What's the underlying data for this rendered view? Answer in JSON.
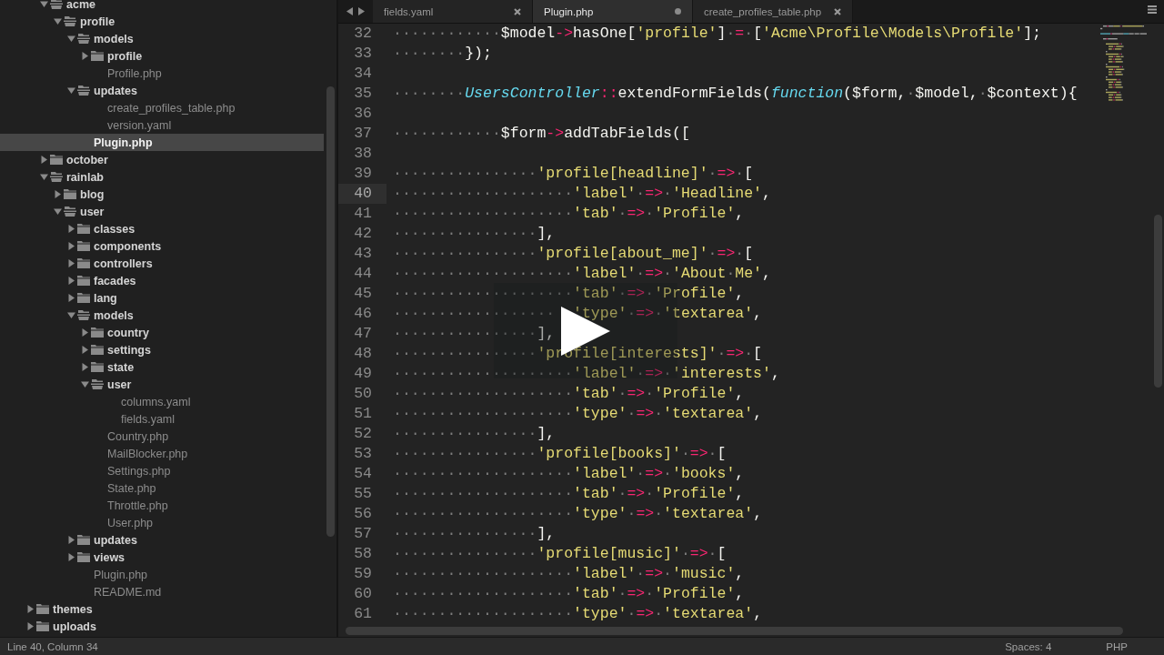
{
  "sidebar": {
    "tree": [
      {
        "children": [
          {
            "name": "acme",
            "kind": "folder",
            "expanded": true,
            "selected": false,
            "children": [
              {
                "name": "profile",
                "kind": "folder",
                "expanded": true,
                "selected": false,
                "children": [
                  {
                    "name": "models",
                    "kind": "folder",
                    "expanded": true,
                    "selected": false,
                    "children": [
                      {
                        "name": "profile",
                        "kind": "folder",
                        "expanded": false,
                        "selected": false
                      },
                      {
                        "name": "Profile.php",
                        "kind": "file",
                        "selected": false
                      }
                    ]
                  },
                  {
                    "name": "updates",
                    "kind": "folder",
                    "expanded": true,
                    "selected": false,
                    "children": [
                      {
                        "name": "create_profiles_table.php",
                        "kind": "file",
                        "selected": false
                      },
                      {
                        "name": "version.yaml",
                        "kind": "file",
                        "selected": false
                      }
                    ]
                  },
                  {
                    "name": "Plugin.php",
                    "kind": "file",
                    "selected": true
                  }
                ]
              }
            ]
          },
          {
            "name": "october",
            "kind": "folder",
            "expanded": false,
            "selected": false
          },
          {
            "name": "rainlab",
            "kind": "folder",
            "expanded": true,
            "selected": false,
            "children": [
              {
                "name": "blog",
                "kind": "folder",
                "expanded": false,
                "selected": false
              },
              {
                "name": "user",
                "kind": "folder",
                "expanded": true,
                "selected": false,
                "children": [
                  {
                    "name": "classes",
                    "kind": "folder",
                    "expanded": false,
                    "selected": false
                  },
                  {
                    "name": "components",
                    "kind": "folder",
                    "expanded": false,
                    "selected": false
                  },
                  {
                    "name": "controllers",
                    "kind": "folder",
                    "expanded": false,
                    "selected": false
                  },
                  {
                    "name": "facades",
                    "kind": "folder",
                    "expanded": false,
                    "selected": false
                  },
                  {
                    "name": "lang",
                    "kind": "folder",
                    "expanded": false,
                    "selected": false
                  },
                  {
                    "name": "models",
                    "kind": "folder",
                    "expanded": true,
                    "selected": false,
                    "children": [
                      {
                        "name": "country",
                        "kind": "folder",
                        "expanded": false,
                        "selected": false
                      },
                      {
                        "name": "settings",
                        "kind": "folder",
                        "expanded": false,
                        "selected": false
                      },
                      {
                        "name": "state",
                        "kind": "folder",
                        "expanded": false,
                        "selected": false
                      },
                      {
                        "name": "user",
                        "kind": "folder",
                        "expanded": true,
                        "selected": false,
                        "children": [
                          {
                            "name": "columns.yaml",
                            "kind": "file",
                            "selected": false
                          },
                          {
                            "name": "fields.yaml",
                            "kind": "file",
                            "selected": false
                          }
                        ]
                      },
                      {
                        "name": "Country.php",
                        "kind": "file",
                        "selected": false
                      },
                      {
                        "name": "MailBlocker.php",
                        "kind": "file",
                        "selected": false
                      },
                      {
                        "name": "Settings.php",
                        "kind": "file",
                        "selected": false
                      },
                      {
                        "name": "State.php",
                        "kind": "file",
                        "selected": false
                      },
                      {
                        "name": "Throttle.php",
                        "kind": "file",
                        "selected": false
                      },
                      {
                        "name": "User.php",
                        "kind": "file",
                        "selected": false
                      }
                    ]
                  },
                  {
                    "name": "updates",
                    "kind": "folder",
                    "expanded": false,
                    "selected": false
                  },
                  {
                    "name": "views",
                    "kind": "folder",
                    "expanded": false,
                    "selected": false
                  },
                  {
                    "name": "Plugin.php",
                    "kind": "file",
                    "selected": false
                  },
                  {
                    "name": "README.md",
                    "kind": "file",
                    "selected": false
                  }
                ]
              }
            ]
          }
        ]
      },
      {
        "name": "themes",
        "kind": "folder",
        "expanded": false,
        "selected": false
      },
      {
        "name": "uploads",
        "kind": "folder",
        "expanded": false,
        "selected": false
      }
    ]
  },
  "tabs": [
    {
      "label": "fields.yaml",
      "selected": false,
      "modified": false
    },
    {
      "label": "Plugin.php",
      "selected": true,
      "modified": true
    },
    {
      "label": "create_profiles_table.php",
      "selected": false,
      "modified": false
    }
  ],
  "code": [
    {
      "n": "32",
      "current": false,
      "tokens": [
        {
          "kind": "ws",
          "text": "············"
        },
        {
          "kind": "plain",
          "text": "$model"
        },
        {
          "kind": "op",
          "text": "->"
        },
        {
          "kind": "plain",
          "text": "hasOne["
        },
        {
          "kind": "str",
          "text": "'profile'"
        },
        {
          "kind": "plain",
          "text": "]"
        },
        {
          "kind": "ws",
          "text": "·"
        },
        {
          "kind": "op",
          "text": "="
        },
        {
          "kind": "ws",
          "text": "·"
        },
        {
          "kind": "plain",
          "text": "["
        },
        {
          "kind": "str",
          "text": "'Acme\\Profile\\Models\\Profile'"
        },
        {
          "kind": "plain",
          "text": "];"
        }
      ]
    },
    {
      "n": "33",
      "current": false,
      "tokens": [
        {
          "kind": "ws",
          "text": "········"
        },
        {
          "kind": "plain",
          "text": "});"
        }
      ]
    },
    {
      "n": "34",
      "current": false
    },
    {
      "n": "35",
      "current": false,
      "tokens": [
        {
          "kind": "ws",
          "text": "········"
        },
        {
          "kind": "cls",
          "text": "UsersController"
        },
        {
          "kind": "op",
          "text": "::"
        },
        {
          "kind": "plain",
          "text": "extendFormFields("
        },
        {
          "kind": "kw",
          "text": "function"
        },
        {
          "kind": "plain",
          "text": "($form,"
        },
        {
          "kind": "ws",
          "text": "·"
        },
        {
          "kind": "plain",
          "text": "$model,"
        },
        {
          "kind": "ws",
          "text": "·"
        },
        {
          "kind": "plain",
          "text": "$context){"
        }
      ]
    },
    {
      "n": "36",
      "current": false
    },
    {
      "n": "37",
      "current": false,
      "tokens": [
        {
          "kind": "ws",
          "text": "············"
        },
        {
          "kind": "plain",
          "text": "$form"
        },
        {
          "kind": "op",
          "text": "->"
        },
        {
          "kind": "plain",
          "text": "addTabFields(["
        }
      ]
    },
    {
      "n": "38",
      "current": false
    },
    {
      "n": "39",
      "current": false,
      "tokens": [
        {
          "kind": "ws",
          "text": "················"
        },
        {
          "kind": "str",
          "text": "'profile[headline]'"
        },
        {
          "kind": "ws",
          "text": "·"
        },
        {
          "kind": "op",
          "text": "=>"
        },
        {
          "kind": "ws",
          "text": "·"
        },
        {
          "kind": "plain",
          "text": "["
        }
      ]
    },
    {
      "n": "40",
      "current": true,
      "tokens": [
        {
          "kind": "ws",
          "text": "····················"
        },
        {
          "kind": "str",
          "text": "'label'"
        },
        {
          "kind": "ws",
          "text": "·"
        },
        {
          "kind": "op",
          "text": "=>"
        },
        {
          "kind": "ws",
          "text": "·"
        },
        {
          "kind": "str",
          "text": "'Headline'"
        },
        {
          "kind": "plain",
          "text": ","
        }
      ]
    },
    {
      "n": "41",
      "current": false,
      "tokens": [
        {
          "kind": "ws",
          "text": "····················"
        },
        {
          "kind": "str",
          "text": "'tab'"
        },
        {
          "kind": "ws",
          "text": "·"
        },
        {
          "kind": "op",
          "text": "=>"
        },
        {
          "kind": "ws",
          "text": "·"
        },
        {
          "kind": "str",
          "text": "'Profile'"
        },
        {
          "kind": "plain",
          "text": ","
        }
      ]
    },
    {
      "n": "42",
      "current": false,
      "tokens": [
        {
          "kind": "ws",
          "text": "················"
        },
        {
          "kind": "plain",
          "text": "],"
        }
      ]
    },
    {
      "n": "43",
      "current": false,
      "tokens": [
        {
          "kind": "ws",
          "text": "················"
        },
        {
          "kind": "str",
          "text": "'profile[about_me]'"
        },
        {
          "kind": "ws",
          "text": "·"
        },
        {
          "kind": "op",
          "text": "=>"
        },
        {
          "kind": "ws",
          "text": "·"
        },
        {
          "kind": "plain",
          "text": "["
        }
      ]
    },
    {
      "n": "44",
      "current": false,
      "tokens": [
        {
          "kind": "ws",
          "text": "····················"
        },
        {
          "kind": "str",
          "text": "'label'"
        },
        {
          "kind": "ws",
          "text": "·"
        },
        {
          "kind": "op",
          "text": "=>"
        },
        {
          "kind": "ws",
          "text": "·"
        },
        {
          "kind": "str",
          "text": "'About"
        },
        {
          "kind": "ws",
          "text": "·"
        },
        {
          "kind": "str",
          "text": "Me'"
        },
        {
          "kind": "plain",
          "text": ","
        }
      ]
    },
    {
      "n": "45",
      "current": false,
      "tokens": [
        {
          "kind": "ws",
          "text": "····················"
        },
        {
          "kind": "str",
          "text": "'tab'"
        },
        {
          "kind": "ws",
          "text": "·"
        },
        {
          "kind": "op",
          "text": "=>"
        },
        {
          "kind": "ws",
          "text": "·"
        },
        {
          "kind": "str",
          "text": "'Profile'"
        },
        {
          "kind": "plain",
          "text": ","
        }
      ]
    },
    {
      "n": "46",
      "current": false,
      "tokens": [
        {
          "kind": "ws",
          "text": "··················"
        },
        {
          "kind": "covered"
        },
        {
          "kind": "str",
          "text": "'type'"
        },
        {
          "kind": "ws",
          "text": "·"
        },
        {
          "kind": "op",
          "text": "=>"
        },
        {
          "kind": "ws",
          "text": "·"
        },
        {
          "kind": "str",
          "text": "'textarea'"
        },
        {
          "kind": "plain",
          "text": ","
        }
      ]
    },
    {
      "n": "47",
      "current": false,
      "tokens": [
        {
          "kind": "ws",
          "text": "················"
        },
        {
          "kind": "plain",
          "text": "],"
        }
      ]
    },
    {
      "n": "48",
      "current": false,
      "tokens": [
        {
          "kind": "ws",
          "text": "················"
        },
        {
          "kind": "str",
          "text": "'profile[interests]'"
        },
        {
          "kind": "ws",
          "text": "·"
        },
        {
          "kind": "op",
          "text": "=>"
        },
        {
          "kind": "ws",
          "text": "·"
        },
        {
          "kind": "plain",
          "text": "["
        }
      ]
    },
    {
      "n": "49",
      "current": false,
      "tokens": [
        {
          "kind": "ws",
          "text": "····················"
        },
        {
          "kind": "str",
          "text": "'label'"
        },
        {
          "kind": "ws",
          "text": "·"
        },
        {
          "kind": "op",
          "text": "=>"
        },
        {
          "kind": "ws",
          "text": "·"
        },
        {
          "kind": "str",
          "text": "'interests'"
        },
        {
          "kind": "plain",
          "text": ","
        }
      ]
    },
    {
      "n": "50",
      "current": false,
      "tokens": [
        {
          "kind": "ws",
          "text": "····················"
        },
        {
          "kind": "str",
          "text": "'tab'"
        },
        {
          "kind": "ws",
          "text": "·"
        },
        {
          "kind": "op",
          "text": "=>"
        },
        {
          "kind": "ws",
          "text": "·"
        },
        {
          "kind": "str",
          "text": "'Profile'"
        },
        {
          "kind": "plain",
          "text": ","
        }
      ]
    },
    {
      "n": "51",
      "current": false,
      "tokens": [
        {
          "kind": "ws",
          "text": "····················"
        },
        {
          "kind": "str",
          "text": "'type'"
        },
        {
          "kind": "ws",
          "text": "·"
        },
        {
          "kind": "op",
          "text": "=>"
        },
        {
          "kind": "ws",
          "text": "·"
        },
        {
          "kind": "str",
          "text": "'textarea'"
        },
        {
          "kind": "plain",
          "text": ","
        }
      ]
    },
    {
      "n": "52",
      "current": false,
      "tokens": [
        {
          "kind": "ws",
          "text": "················"
        },
        {
          "kind": "plain",
          "text": "],"
        }
      ]
    },
    {
      "n": "53",
      "current": false,
      "tokens": [
        {
          "kind": "ws",
          "text": "················"
        },
        {
          "kind": "str",
          "text": "'profile[books]'"
        },
        {
          "kind": "ws",
          "text": "·"
        },
        {
          "kind": "op",
          "text": "=>"
        },
        {
          "kind": "ws",
          "text": "·"
        },
        {
          "kind": "plain",
          "text": "["
        }
      ]
    },
    {
      "n": "54",
      "current": false,
      "tokens": [
        {
          "kind": "ws",
          "text": "····················"
        },
        {
          "kind": "str",
          "text": "'label'"
        },
        {
          "kind": "ws",
          "text": "·"
        },
        {
          "kind": "op",
          "text": "=>"
        },
        {
          "kind": "ws",
          "text": "·"
        },
        {
          "kind": "str",
          "text": "'books'"
        },
        {
          "kind": "plain",
          "text": ","
        }
      ]
    },
    {
      "n": "55",
      "current": false,
      "tokens": [
        {
          "kind": "ws",
          "text": "····················"
        },
        {
          "kind": "str",
          "text": "'tab'"
        },
        {
          "kind": "ws",
          "text": "·"
        },
        {
          "kind": "op",
          "text": "=>"
        },
        {
          "kind": "ws",
          "text": "·"
        },
        {
          "kind": "str",
          "text": "'Profile'"
        },
        {
          "kind": "plain",
          "text": ","
        }
      ]
    },
    {
      "n": "56",
      "current": false,
      "tokens": [
        {
          "kind": "ws",
          "text": "····················"
        },
        {
          "kind": "str",
          "text": "'type'"
        },
        {
          "kind": "ws",
          "text": "·"
        },
        {
          "kind": "op",
          "text": "=>"
        },
        {
          "kind": "ws",
          "text": "·"
        },
        {
          "kind": "str",
          "text": "'textarea'"
        },
        {
          "kind": "plain",
          "text": ","
        }
      ]
    },
    {
      "n": "57",
      "current": false,
      "tokens": [
        {
          "kind": "ws",
          "text": "················"
        },
        {
          "kind": "plain",
          "text": "],"
        }
      ]
    },
    {
      "n": "58",
      "current": false,
      "tokens": [
        {
          "kind": "ws",
          "text": "················"
        },
        {
          "kind": "str",
          "text": "'profile[music]'"
        },
        {
          "kind": "ws",
          "text": "·"
        },
        {
          "kind": "op",
          "text": "=>"
        },
        {
          "kind": "ws",
          "text": "·"
        },
        {
          "kind": "plain",
          "text": "["
        }
      ]
    },
    {
      "n": "59",
      "current": false,
      "tokens": [
        {
          "kind": "ws",
          "text": "····················"
        },
        {
          "kind": "str",
          "text": "'label'"
        },
        {
          "kind": "ws",
          "text": "·"
        },
        {
          "kind": "op",
          "text": "=>"
        },
        {
          "kind": "ws",
          "text": "·"
        },
        {
          "kind": "str",
          "text": "'music'"
        },
        {
          "kind": "plain",
          "text": ","
        }
      ]
    },
    {
      "n": "60",
      "current": false,
      "tokens": [
        {
          "kind": "ws",
          "text": "····················"
        },
        {
          "kind": "str",
          "text": "'tab'"
        },
        {
          "kind": "ws",
          "text": "·"
        },
        {
          "kind": "op",
          "text": "=>"
        },
        {
          "kind": "ws",
          "text": "·"
        },
        {
          "kind": "str",
          "text": "'Profile'"
        },
        {
          "kind": "plain",
          "text": ","
        }
      ]
    },
    {
      "n": "61",
      "current": false,
      "tokens": [
        {
          "kind": "ws",
          "text": "····················"
        },
        {
          "kind": "str",
          "text": "'type'"
        },
        {
          "kind": "ws",
          "text": "·"
        },
        {
          "kind": "op",
          "text": "=>"
        },
        {
          "kind": "ws",
          "text": "·"
        },
        {
          "kind": "str",
          "text": "'textarea'"
        },
        {
          "kind": "plain",
          "text": ","
        }
      ]
    }
  ],
  "status_bar": {
    "position": "Line 40, Column 34",
    "indentation": "Spaces: 4",
    "syntax": "PHP"
  }
}
